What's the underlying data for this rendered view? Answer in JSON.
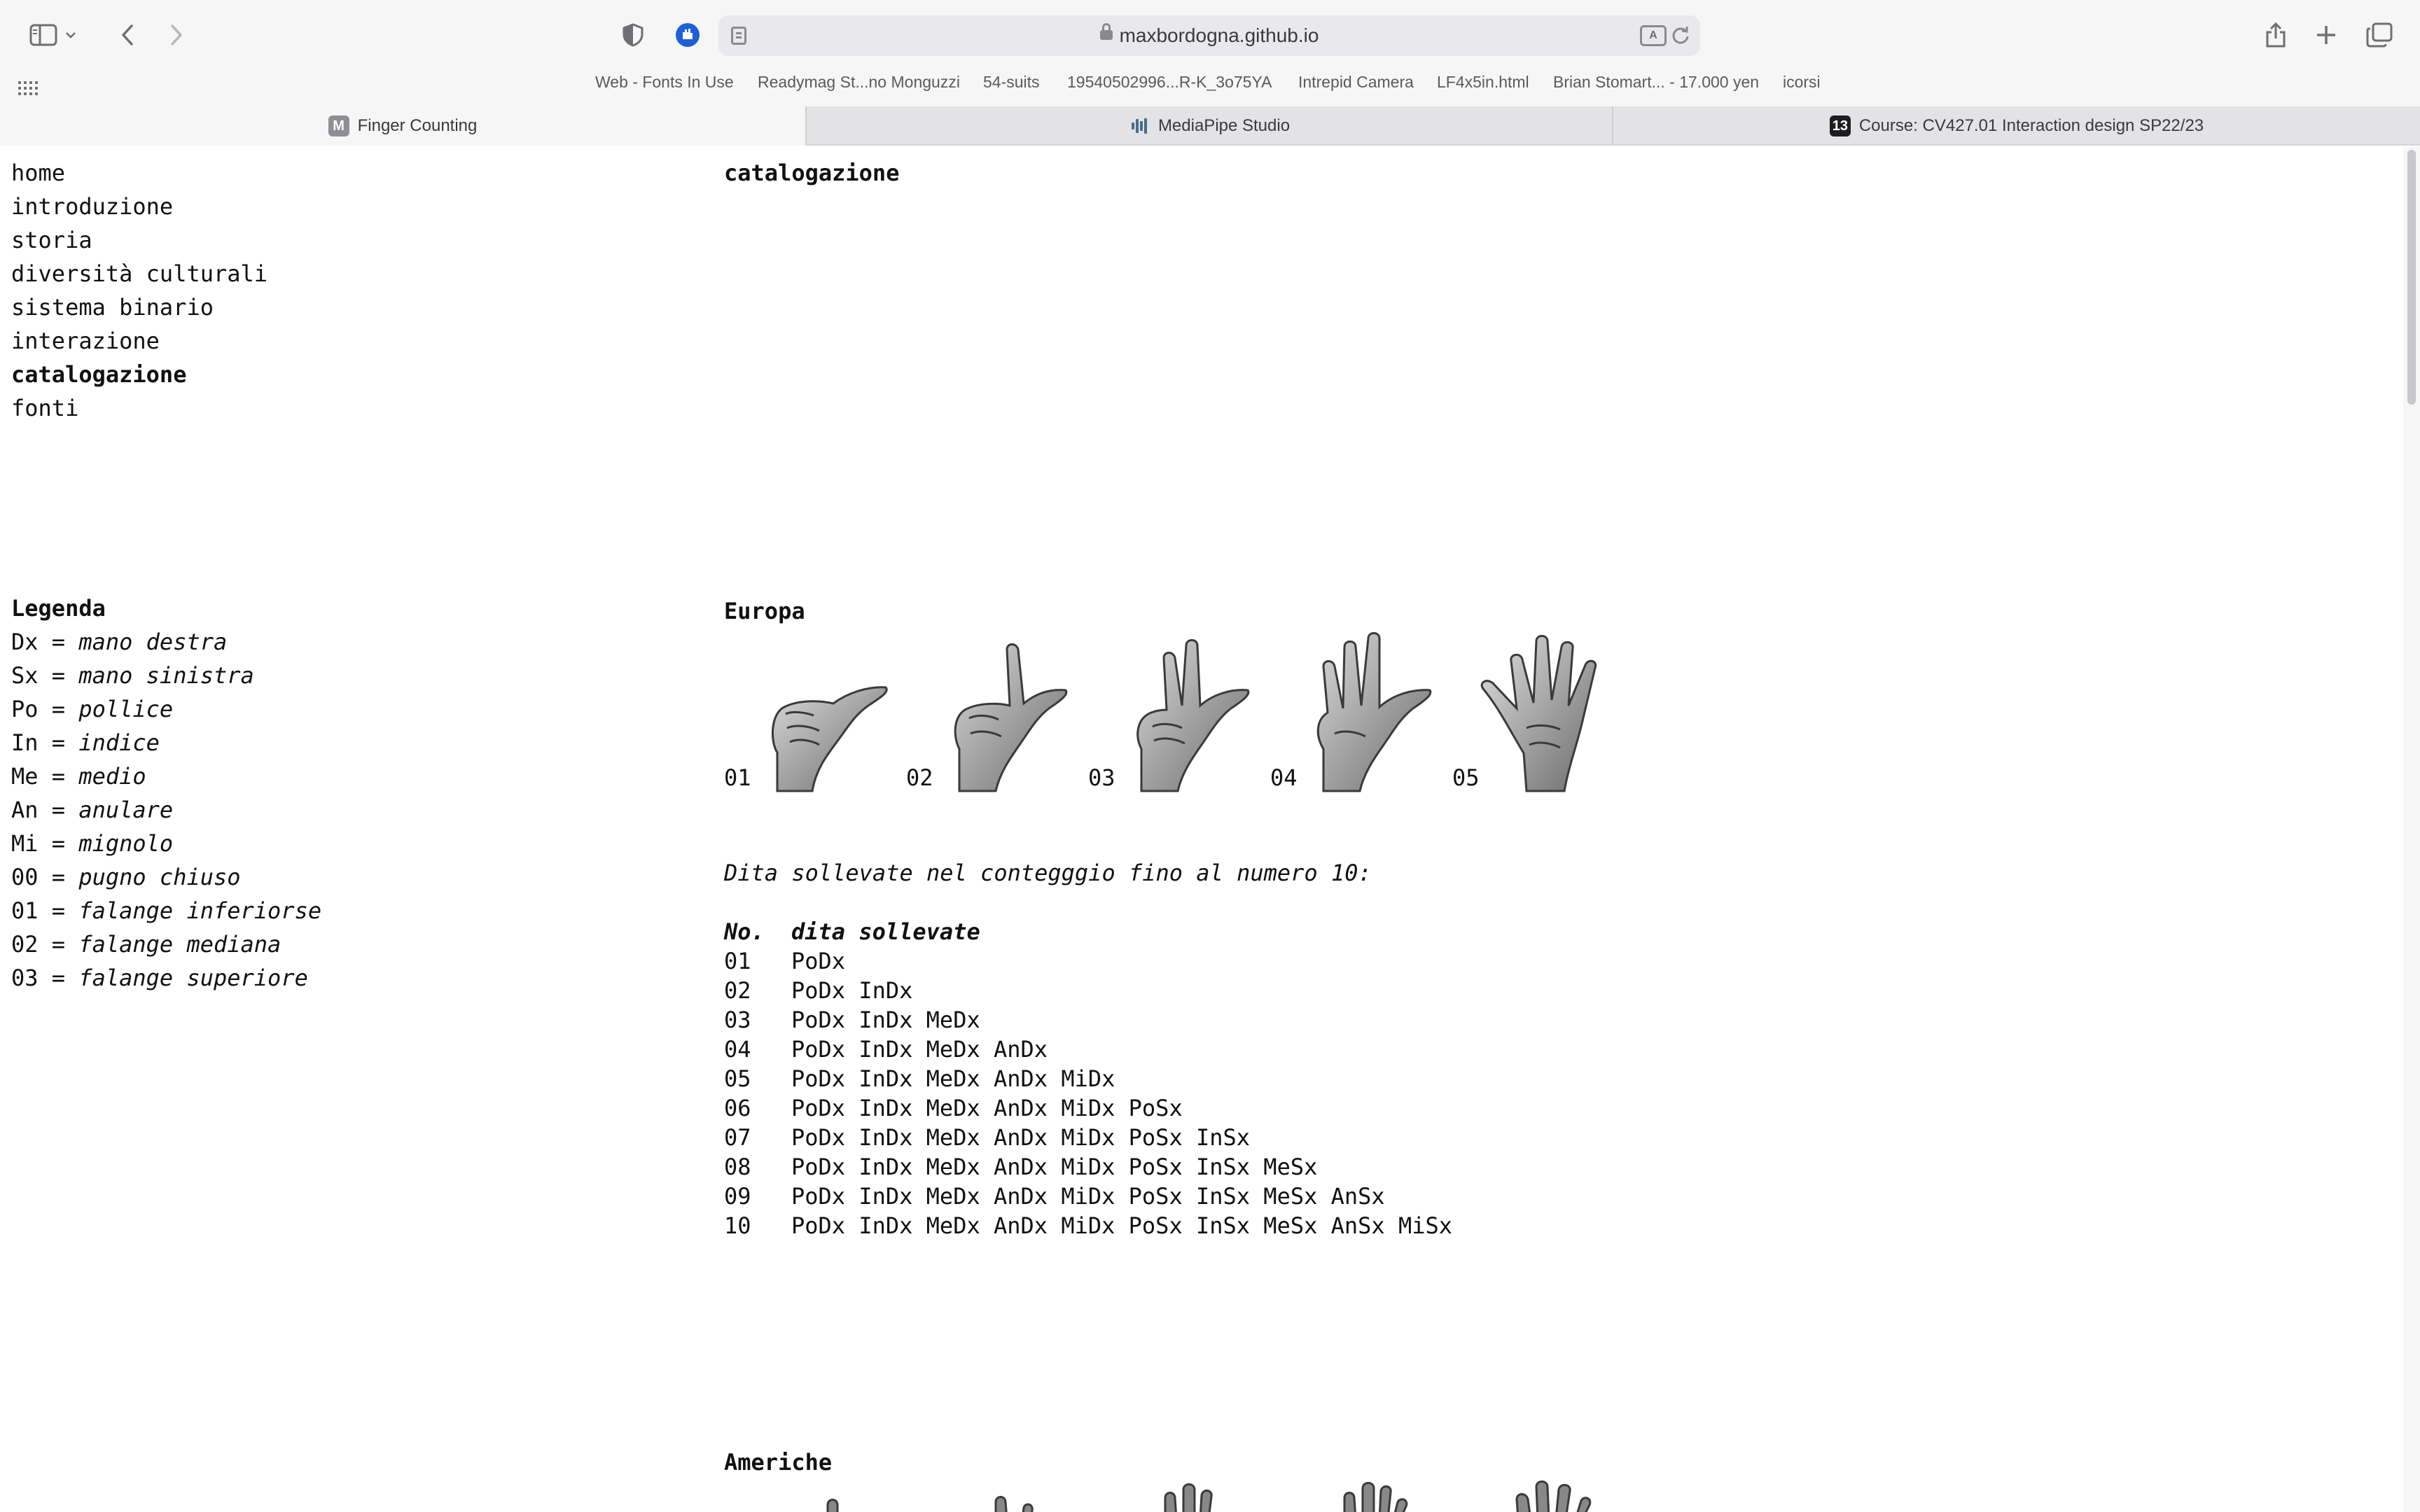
{
  "browser": {
    "url": "maxbordogna.github.io",
    "bookmarks": [
      "Web - Fonts In Use",
      "Readymag St...no Monguzzi",
      "54-suits",
      "19540502996...R-K_3o75YA",
      "Intrepid Camera",
      "LF4x5in.html",
      "Brian Stomart... - 17.000 yen",
      "icorsi"
    ],
    "tabs": [
      {
        "label": "Finger Counting",
        "favicon_letter": "M",
        "active": true
      },
      {
        "label": "MediaPipe Studio",
        "active": false
      },
      {
        "label": "Course: CV427.01 Interaction design SP22/23",
        "favicon_letter": "13",
        "active": false
      }
    ],
    "icons": [
      "sidebar-icon",
      "chevron-down-icon",
      "back-icon",
      "forward-icon",
      "privacy-shield-icon",
      "extension-icon",
      "reader-icon",
      "lock-icon",
      "translate-icon",
      "reload-icon",
      "share-icon",
      "new-tab-icon",
      "tab-overview-icon",
      "grid-icon"
    ]
  },
  "nav": {
    "items": [
      "home",
      "introduzione",
      "storia",
      "diversità culturali",
      "sistema binario",
      "interazione",
      "catalogazione",
      "fonti"
    ],
    "active_index": 6
  },
  "legend": {
    "title": "Legenda",
    "rows": [
      {
        "key": "Dx",
        "value": "mano destra"
      },
      {
        "key": "Sx",
        "value": "mano sinistra"
      },
      {
        "key": "Po",
        "value": "pollice"
      },
      {
        "key": "In",
        "value": "indice"
      },
      {
        "key": "Me",
        "value": "medio"
      },
      {
        "key": "An",
        "value": "anulare"
      },
      {
        "key": "Mi",
        "value": "mignolo"
      },
      {
        "key": "00",
        "value": "pugno chiuso"
      },
      {
        "key": "01",
        "value": "falange inferiorse"
      },
      {
        "key": "02",
        "value": "falange mediana"
      },
      {
        "key": "03",
        "value": "falange superiore"
      }
    ]
  },
  "main": {
    "heading": "catalogazione",
    "europe": {
      "title": "Europa",
      "hands": [
        "01",
        "02",
        "03",
        "04",
        "05"
      ],
      "caption": "Dita sollevate nel contegggio fino al numero 10:",
      "table": {
        "headers": [
          "No.",
          "dita sollevate"
        ],
        "rows": [
          [
            "01",
            "PoDx"
          ],
          [
            "02",
            "PoDx InDx"
          ],
          [
            "03",
            "PoDx InDx MeDx"
          ],
          [
            "04",
            "PoDx InDx MeDx AnDx"
          ],
          [
            "05",
            "PoDx InDx MeDx AnDx MiDx"
          ],
          [
            "06",
            "PoDx InDx MeDx AnDx MiDx PoSx"
          ],
          [
            "07",
            "PoDx InDx MeDx AnDx MiDx PoSx InSx"
          ],
          [
            "08",
            "PoDx InDx MeDx AnDx MiDx PoSx InSx MeSx"
          ],
          [
            "09",
            "PoDx InDx MeDx AnDx MiDx PoSx InSx MeSx AnSx"
          ],
          [
            "10",
            "PoDx InDx MeDx AnDx MiDx PoSx InSx MeSx AnSx MiSx"
          ]
        ]
      }
    },
    "americas": {
      "title": "Americhe"
    }
  }
}
